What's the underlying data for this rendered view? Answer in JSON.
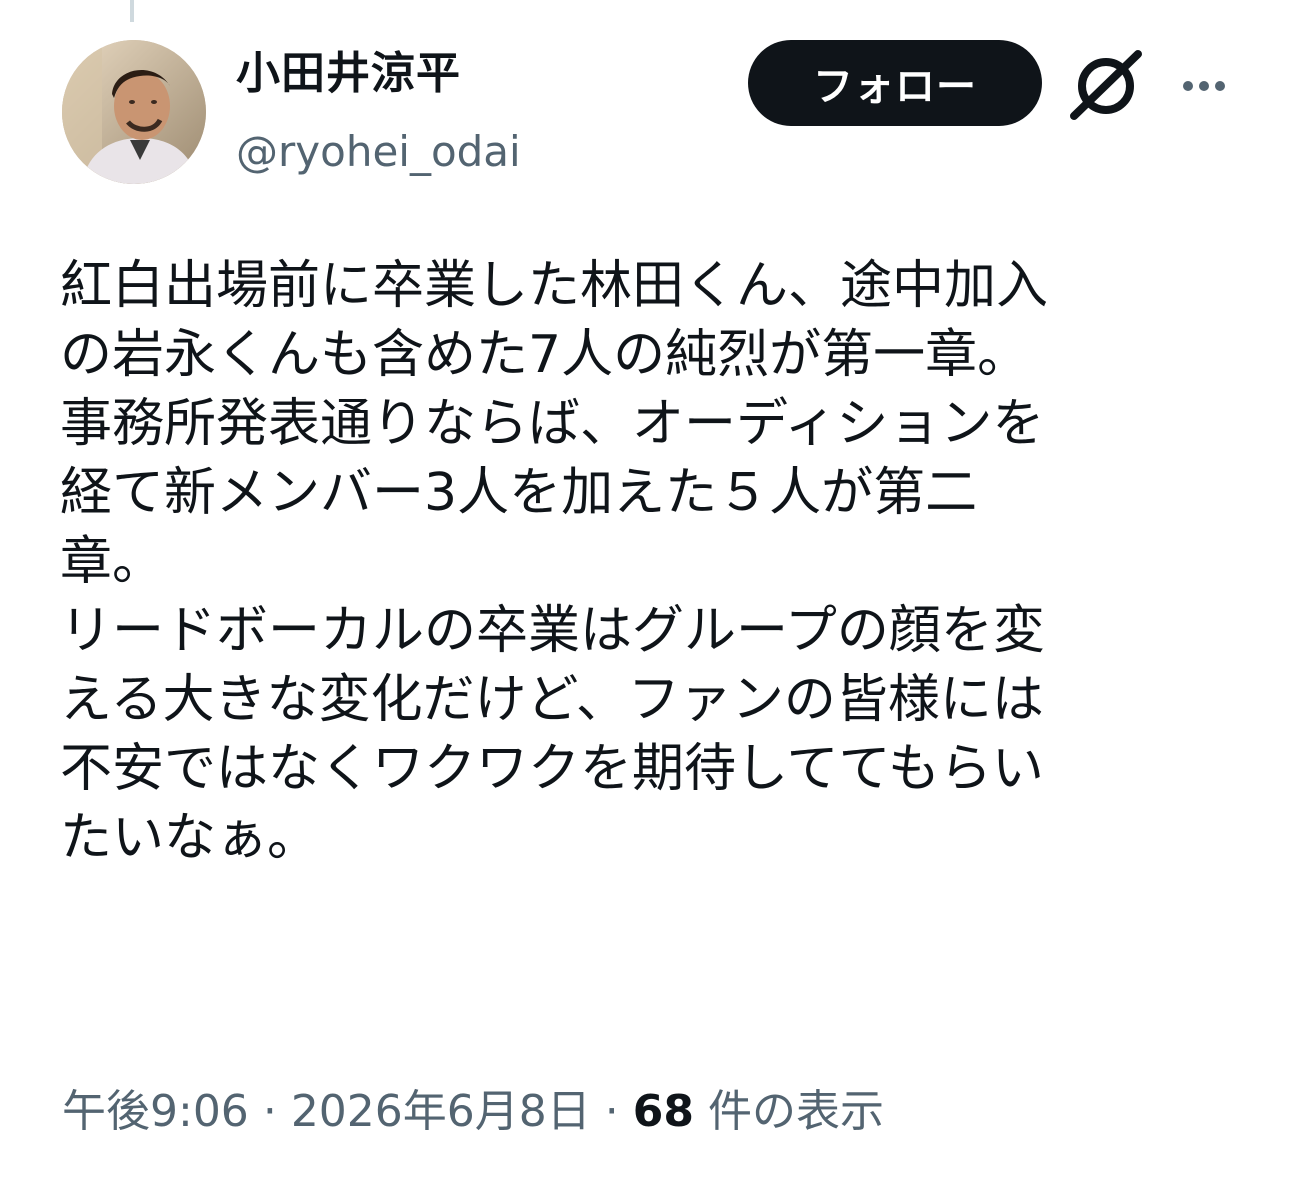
{
  "user": {
    "display_name": "小田井涼平",
    "handle": "@ryohei_odai",
    "avatar_icon": "avatar-photo"
  },
  "actions": {
    "follow_label": "フォロー",
    "grok_icon": "grok-icon",
    "more_icon": "more-icon"
  },
  "tweet": {
    "text": "紅白出場前に卒業した林田くん、途中加入\nの岩永くんも含めた7人の純烈が第一章。\n事務所発表通りならば、オーディションを\n経て新メンバー3人を加えた５人が第二\n章。\nリードボーカルの卒業はグループの顔を変\nえる大きな変化だけど、ファンの皆様には\n不安ではなくワクワクを期待しててもらい\nたいなぁ。"
  },
  "meta": {
    "time": "午後9:06",
    "separator": "·",
    "date": "2026年6月8日",
    "views_count": "68",
    "views_label": "件の表示"
  },
  "colors": {
    "text_primary": "#0f1419",
    "text_secondary": "#536471",
    "button_bg": "#0f1419",
    "button_text": "#ffffff"
  }
}
